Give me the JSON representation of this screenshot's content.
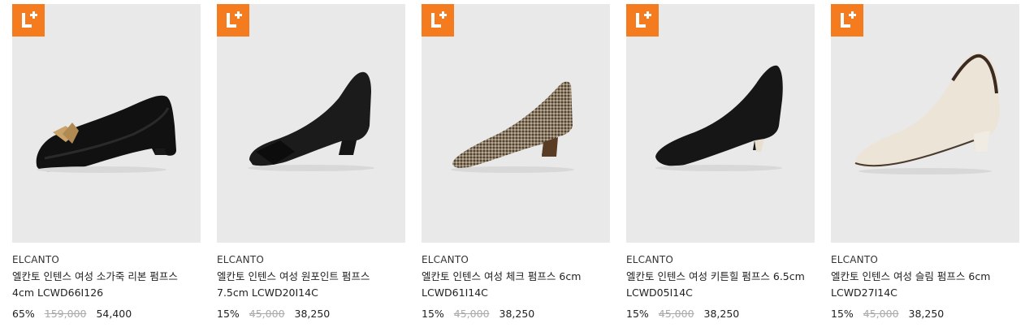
{
  "badge_color": "#f47b1e",
  "products": [
    {
      "brand": "ELCANTO",
      "name": "엘칸토 인텐스 여성 소가죽 리본 펌프스 4cm LCWD66I126",
      "discount": "65%",
      "original_price": "159,000",
      "sale_price": "54,400",
      "badge_icon": "l-plus-icon"
    },
    {
      "brand": "ELCANTO",
      "name": "엘칸토 인텐스 여성 원포인트 펌프스 7.5cm LCWD20I14C",
      "discount": "15%",
      "original_price": "45,000",
      "sale_price": "38,250",
      "badge_icon": "l-plus-icon"
    },
    {
      "brand": "ELCANTO",
      "name": "엘칸토 인텐스 여성 체크 펌프스 6cm LCWD61I14C",
      "discount": "15%",
      "original_price": "45,000",
      "sale_price": "38,250",
      "badge_icon": "l-plus-icon"
    },
    {
      "brand": "ELCANTO",
      "name": "엘칸토 인텐스 여성 키튼힐 펌프스 6.5cm LCWD05I14C",
      "discount": "15%",
      "original_price": "45,000",
      "sale_price": "38,250",
      "badge_icon": "l-plus-icon"
    },
    {
      "brand": "ELCANTO",
      "name": "엘칸토 인텐스 여성 슬림 펌프스 6cm LCWD27I14C",
      "discount": "15%",
      "original_price": "45,000",
      "sale_price": "38,250",
      "badge_icon": "l-plus-icon"
    }
  ]
}
